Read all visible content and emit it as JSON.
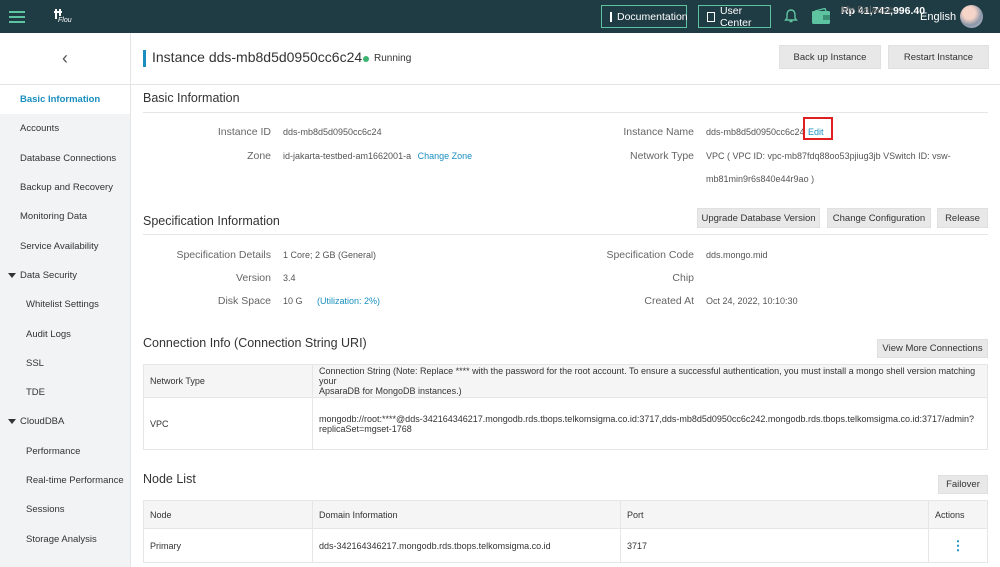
{
  "topbar": {
    "logo_text": "Flou",
    "documentation": "Documentation",
    "user_center": "User Center",
    "balance_label": "My Balance",
    "balance_amount": "Rp 41,742,996.40",
    "language": "English"
  },
  "sidebar": {
    "back": "‹",
    "items": [
      {
        "label": "Basic Information"
      },
      {
        "label": "Accounts"
      },
      {
        "label": "Database Connections"
      },
      {
        "label": "Backup and Recovery"
      },
      {
        "label": "Monitoring Data"
      },
      {
        "label": "Service Availability"
      },
      {
        "label": "Data Security"
      },
      {
        "label": "Whitelist Settings"
      },
      {
        "label": "Audit Logs"
      },
      {
        "label": "SSL"
      },
      {
        "label": "TDE"
      },
      {
        "label": "CloudDBA"
      },
      {
        "label": "Performance"
      },
      {
        "label": "Real-time Performance"
      },
      {
        "label": "Sessions"
      },
      {
        "label": "Storage Analysis"
      }
    ]
  },
  "header": {
    "title": "Instance dds-mb8d5d0950cc6c24",
    "status": "Running",
    "backup_btn": "Back up Instance",
    "restart_btn": "Restart Instance"
  },
  "basic": {
    "title": "Basic Information",
    "instance_id_label": "Instance ID",
    "instance_id": "dds-mb8d5d0950cc6c24",
    "zone_label": "Zone",
    "zone": "id-jakarta-testbed-am1662001-a",
    "change_zone": "Change Zone",
    "instance_name_label": "Instance Name",
    "instance_name": "dds-mb8d5d0950cc6c24",
    "edit": "Edit",
    "network_type_label": "Network Type",
    "network_type_line1": "VPC ( VPC ID: vpc-mb87fdq88oo53pjiug3jb VSwitch ID: vsw-",
    "network_type_line2": "mb81min9r6s840e44r9ao )"
  },
  "spec": {
    "title": "Specification Information",
    "upgrade_btn": "Upgrade Database Version",
    "change_btn": "Change Configuration",
    "release_btn": "Release",
    "details_label": "Specification Details",
    "details": "1 Core; 2 GB (General)",
    "version_label": "Version",
    "version": "3.4",
    "disk_label": "Disk Space",
    "disk": "10 G",
    "utilization": "(Utilization: 2%)",
    "code_label": "Specification Code",
    "code": "dds.mongo.mid",
    "chip_label": "Chip",
    "created_label": "Created At",
    "created": "Oct 24, 2022, 10:10:30"
  },
  "connection": {
    "title": "Connection Info (Connection String URI)",
    "more_btn": "View More Connections",
    "col_network": "Network Type",
    "col_string_line1": "Connection String (Note: Replace **** with the password for the root account. To ensure a successful authentication, you must install a mongo shell version matching your",
    "col_string_line2": "ApsaraDB for MongoDB instances.)",
    "row_network": "VPC",
    "row_string_line1": "mongodb://root:****@dds-342164346217.mongodb.rds.tbops.telkomsigma.co.id:3717,dds-mb8d5d0950cc6c242.mongodb.rds.tbops.telkomsigma.co.id:3717/admin?",
    "row_string_line2": "replicaSet=mgset-1768"
  },
  "nodes": {
    "title": "Node List",
    "failover_btn": "Failover",
    "columns": [
      "Node",
      "Domain Information",
      "Port",
      "Actions"
    ],
    "rows": [
      {
        "node": "Primary",
        "domain": "dds-342164346217.mongodb.rds.tbops.telkomsigma.co.id",
        "port": "3717",
        "actions": "⋮"
      }
    ]
  }
}
